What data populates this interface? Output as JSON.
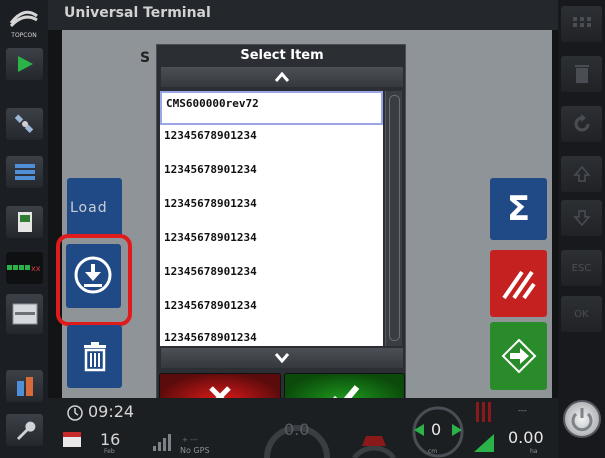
{
  "app": {
    "title": "Universal Terminal",
    "heading_partial": "S"
  },
  "logo_text": "TOPCON",
  "left_sidebar": {
    "items": [
      {
        "name": "guidance-icon"
      },
      {
        "name": "satellite-icon"
      },
      {
        "name": "layers-icon"
      },
      {
        "name": "device-icon"
      },
      {
        "name": "section-status-icon"
      },
      {
        "name": "window-icon"
      },
      {
        "name": "storage-icon"
      },
      {
        "name": "wrench-icon"
      }
    ]
  },
  "right_sidebar": {
    "items": [
      {
        "name": "keypad-icon"
      },
      {
        "name": "trash-icon"
      },
      {
        "name": "refresh-icon"
      },
      {
        "name": "arrow-up-icon"
      },
      {
        "name": "arrow-down-icon"
      },
      {
        "name": "esc",
        "label": "ESC"
      },
      {
        "name": "ok",
        "label": "OK"
      }
    ]
  },
  "actions": {
    "load_label": "Load"
  },
  "modal": {
    "title": "Select Item",
    "items": [
      "CMS600000rev72",
      "12345678901234",
      "12345678901234",
      "12345678901234",
      "12345678901234",
      "12345678901234",
      "12345678901234",
      "12345678901234"
    ],
    "selected_index": 0
  },
  "status": {
    "time": "09:24",
    "day": "16",
    "month": "Feb",
    "gps_status": "No GPS",
    "gps_sub": "+ ---",
    "speed": "0.0",
    "depth": "0",
    "depth_unit": "cm",
    "area": "0.00",
    "area_unit": "ha",
    "rate": "---"
  },
  "colors": {
    "accent_blue": "#1f4a86",
    "highlight_red": "#e01b1b",
    "reset_red": "#c62121",
    "continue_green": "#2a8b2a"
  }
}
